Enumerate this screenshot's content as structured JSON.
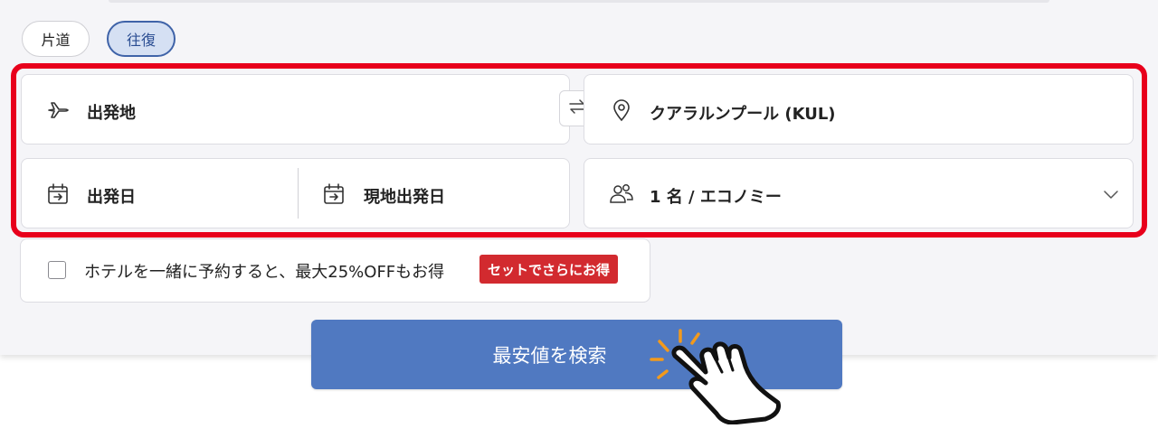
{
  "trip_type": {
    "options": [
      "片道",
      "往復"
    ],
    "selected": "往復"
  },
  "origin": {
    "label": "出発地",
    "icon": "airplane-icon"
  },
  "destination": {
    "value": "クアラルンプール (KUL)",
    "icon": "map-pin-icon"
  },
  "swap": {
    "icon": "swap-arrows-icon"
  },
  "dates": {
    "departure_label": "出発日",
    "return_label": "現地出発日",
    "icon": "calendar-icon"
  },
  "passengers": {
    "value": "1 名 / エコノミー",
    "icon": "people-icon",
    "dropdown_icon": "chevron-down-icon"
  },
  "hotel_bundle": {
    "label": "ホテルを一緒に予約すると、最大25%OFFもお得",
    "badge": "セットでさらにお得",
    "checked": false
  },
  "search_button": {
    "label": "最安値を検索"
  },
  "colors": {
    "highlight": "#e8001c",
    "primary_button": "#5079c1",
    "badge": "#d22a2f",
    "selected_pill": "#d5e0f3"
  }
}
